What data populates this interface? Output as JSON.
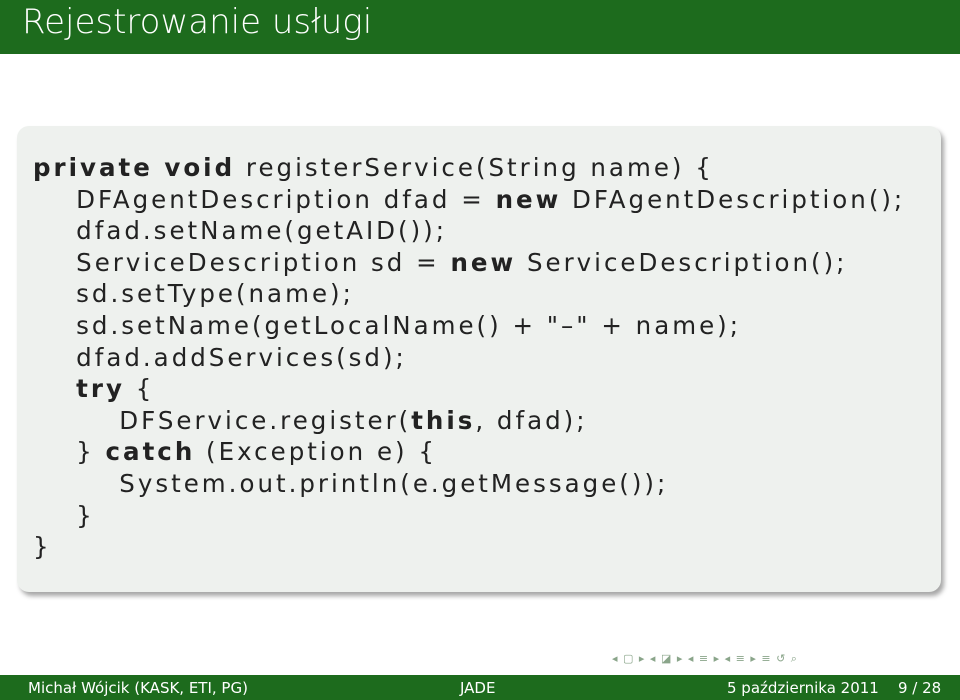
{
  "slide": {
    "title": "Rejestrowanie usługi",
    "code_lines": [
      [
        {
          "t": "private void",
          "kw": true
        },
        {
          "t": " registerService(String name) {",
          "kw": false
        }
      ],
      [
        {
          "t": "    DFAgentDescription dfad = ",
          "kw": false
        },
        {
          "t": "new",
          "kw": true
        },
        {
          "t": " DFAgentDescription();",
          "kw": false
        }
      ],
      [
        {
          "t": "    dfad.setName(getAID());",
          "kw": false
        }
      ],
      [
        {
          "t": "    ServiceDescription sd = ",
          "kw": false
        },
        {
          "t": "new",
          "kw": true
        },
        {
          "t": " ServiceDescription();",
          "kw": false
        }
      ],
      [
        {
          "t": "    sd.setType(name);",
          "kw": false
        }
      ],
      [
        {
          "t": "    sd.setName(getLocalName() + \"–\" + name);",
          "kw": false
        }
      ],
      [
        {
          "t": "    dfad.addServices(sd);",
          "kw": false
        }
      ],
      [
        {
          "t": "    ",
          "kw": false
        },
        {
          "t": "try",
          "kw": true
        },
        {
          "t": " {",
          "kw": false
        }
      ],
      [
        {
          "t": "        DFService.register(",
          "kw": false
        },
        {
          "t": "this",
          "kw": true
        },
        {
          "t": ", dfad);",
          "kw": false
        }
      ],
      [
        {
          "t": "    } ",
          "kw": false
        },
        {
          "t": "catch",
          "kw": true
        },
        {
          "t": " (Exception e) {",
          "kw": false
        }
      ],
      [
        {
          "t": "        System.out.println(e.getMessage());",
          "kw": false
        }
      ],
      [
        {
          "t": "    }",
          "kw": false
        }
      ],
      [
        {
          "t": "}",
          "kw": false
        }
      ]
    ]
  },
  "nav": {
    "glyphs": "◂ ▢ ▸ ◂ ◪ ▸ ◂ ≡ ▸ ◂ ≡ ▸ ≡ ↺ ⌕"
  },
  "footer": {
    "author": "Michał Wójcik (KASK, ETI, PG)",
    "topic": "JADE",
    "date": "5 października 2011",
    "page": "9 / 28"
  }
}
